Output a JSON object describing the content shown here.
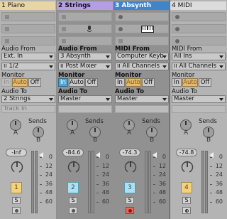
{
  "tracks": [
    {
      "title": "1 Piano",
      "header_color": "#e7d6a4",
      "selected": false,
      "clip_slots": [
        "square",
        "square",
        "square"
      ],
      "audio_from_label": "Audio From",
      "audio_from": "Ext. In",
      "audio_from_channel": "1/2",
      "monitor_label": "Monitor",
      "monitor": [
        "In",
        "Auto",
        "Off"
      ],
      "monitor_active": "Auto",
      "audio_to_label": "Audio To",
      "audio_to": "2 Strings",
      "audio_to_sub": "Track In",
      "sends_label": "Sends",
      "send_a": "A",
      "send_b": "B",
      "volume": "-Inf",
      "track_num": "1",
      "num_color": "y",
      "solo": "S",
      "arm": "off"
    },
    {
      "title": "2 Strings",
      "header_color": "#b59ee6",
      "selected": true,
      "clip_slots": [
        "square",
        "square",
        "square"
      ],
      "input_icon": "microphone-icon",
      "audio_from_label": "Audio From",
      "audio_from": "3 Absynth",
      "audio_from_channel": "Post Mixer",
      "monitor_label": "Monitor",
      "monitor": [
        "In",
        "Auto",
        "Off"
      ],
      "monitor_active": "In",
      "audio_to_label": "Audio To",
      "audio_to": "Master",
      "audio_to_sub": "",
      "sends_label": "Sends",
      "send_a": "A",
      "send_b": "B",
      "volume": "-84.6",
      "track_num": "2",
      "num_color": "b",
      "solo": "S",
      "arm": "off"
    },
    {
      "title": "3 Absynth",
      "header_color": "#3f85c9",
      "selected": true,
      "clip_slots": [
        "circle",
        "circle",
        "square"
      ],
      "input_icon": "keyboard-icon",
      "audio_from_label": "MIDI From",
      "audio_from": "Computer Keyb",
      "audio_from_channel": "All Channels",
      "monitor_label": "Monitor",
      "monitor": [
        "In",
        "Auto",
        "Off"
      ],
      "monitor_active": "Auto",
      "audio_to_label": "Audio To",
      "audio_to": "Master",
      "audio_to_sub": "",
      "sends_label": "Sends",
      "send_a": "A",
      "send_b": "B",
      "volume": "-74.3",
      "track_num": "3",
      "num_color": "b",
      "solo": "S",
      "arm": "on"
    },
    {
      "title": "4 MIDI",
      "header_color": "#dcdcdc",
      "selected": false,
      "clip_slots": [
        "circle",
        "circle",
        "circle"
      ],
      "audio_from_label": "MIDI From",
      "audio_from": "All Ins",
      "audio_from_channel": "All Channels",
      "monitor_label": "Monitor",
      "monitor": [
        "In",
        "Auto",
        "Off"
      ],
      "monitor_active": "Auto",
      "audio_to_label": "Audio To",
      "audio_to": "Master",
      "audio_to_sub": "",
      "sends_label": "Sends",
      "send_a": "A",
      "send_b": "B",
      "volume": "-74.8",
      "track_num": "4",
      "num_color": "y",
      "solo": "S",
      "arm": "half"
    }
  ],
  "meter_scale": [
    "0",
    "12",
    "24",
    "36",
    "48",
    "60"
  ],
  "colors": {
    "selected_bg": "#919191",
    "monitor_in": "#4ba6d8",
    "monitor_auto": "#e7b96a",
    "arm": "#e46a5c"
  }
}
